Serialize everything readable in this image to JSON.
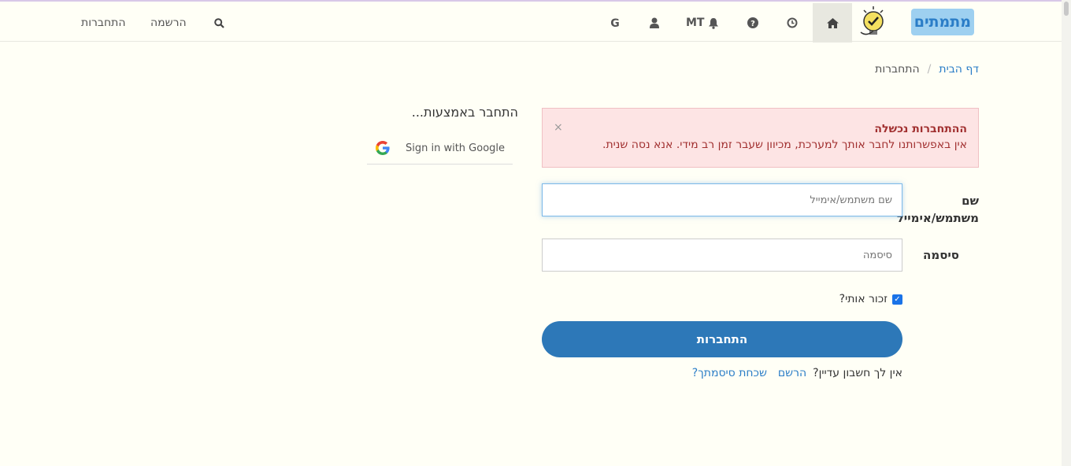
{
  "nav": {
    "logo_text": "מתמתים",
    "mt_label": "MT",
    "register_label": "הרשמה",
    "login_label": "התחברות",
    "home_icon": "home-icon",
    "history_icon": "clock-icon",
    "help_icon": "question-icon",
    "notifications_icon": "bell-icon",
    "user_icon": "user-icon",
    "google_icon": "google-g-icon",
    "search_icon": "search-icon"
  },
  "breadcrumb": {
    "home": "דף הבית",
    "separator": "/",
    "current": "התחברות"
  },
  "alert": {
    "title": "ההתחברות נכשלה",
    "message": "אין באפשרותנו לחבר אותך למערכת, מכיוון שעבר זמן רב מידי. אנא נסה שנית.",
    "close": "×"
  },
  "form": {
    "username_label": "שם משתמש/אימייל",
    "username_placeholder": "שם משתמש/אימייל",
    "password_label": "סיסמה",
    "password_placeholder": "סיסמה",
    "remember_label": "זכור אותי?",
    "remember_checked": true,
    "submit_label": "התחברות",
    "no_account_text": "אין לך חשבון עדיין?",
    "register_link": "הרשם",
    "forgot_link": "שכחת סיסמתך?"
  },
  "social": {
    "heading": "התחבר באמצעות...",
    "google_button": "Sign in with Google"
  },
  "colors": {
    "primary": "#2d78b8",
    "link": "#2a7dc7",
    "alert_bg": "#fde4e4",
    "alert_text": "#a13030",
    "page_bg": "#fffff6"
  }
}
